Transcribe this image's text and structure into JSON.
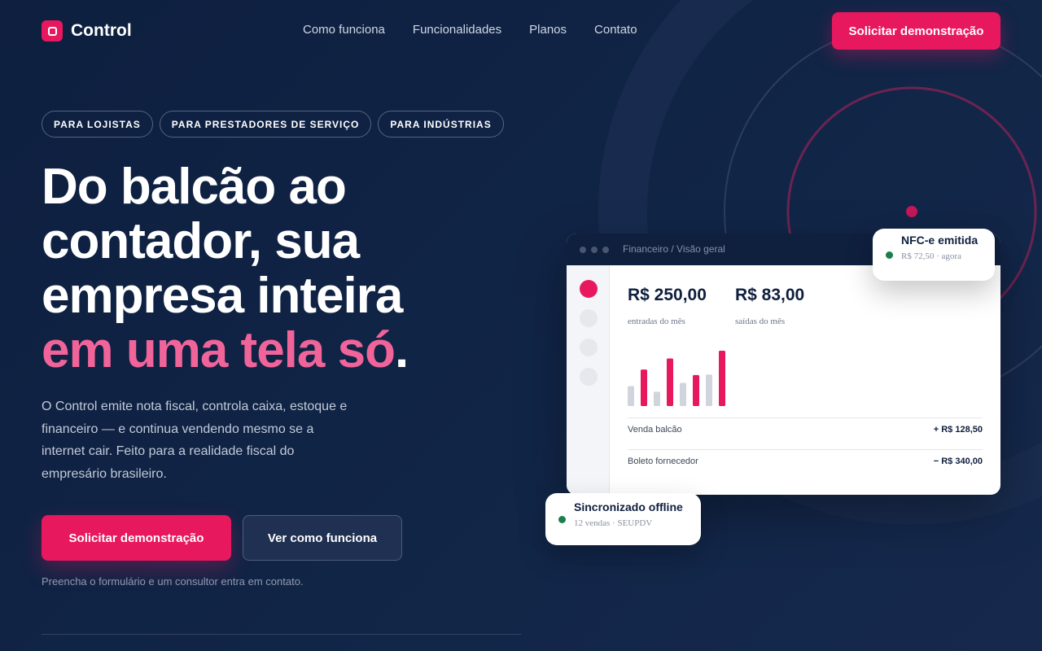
{
  "brand": {
    "name": "Control"
  },
  "nav": {
    "links": [
      "Como funciona",
      "Funcionalidades",
      "Planos",
      "Contato"
    ],
    "cta": "Solicitar demonstração"
  },
  "hero": {
    "tags": [
      "PARA LOJISTAS",
      "PARA PRESTADORES DE SERVIÇO",
      "PARA INDÚSTRIAS"
    ],
    "headline": {
      "line1": "Do balcão ao",
      "line2": "contador, sua",
      "line3": "empresa inteira",
      "accent": "em uma tela só",
      "period": "."
    },
    "description": "O Control emite nota fiscal, controla caixa, estoque e financeiro — e continua vendendo mesmo se a internet cair. Feito para a realidade fiscal do empresário brasileiro.",
    "primary_button": "Solicitar demonstração",
    "secondary_button": "Ver como funciona",
    "note": "Preencha o formulário e um consultor entra em contato."
  },
  "dashboard": {
    "breadcrumb": "Financeiro / Visão geral",
    "stats": [
      {
        "value": "R$ 250,00",
        "label": "entradas do mês"
      },
      {
        "value": "R$ 83,00",
        "label": "saídas do mês"
      }
    ],
    "rows": [
      {
        "label": "Venda balcão",
        "value": "+ R$ 128,50"
      },
      {
        "label": "Boleto fornecedor",
        "value": "− R$ 340,00"
      }
    ],
    "bars": [
      {
        "value": 0.36,
        "accent": false
      },
      {
        "value": 0.66,
        "accent": true
      },
      {
        "value": 0.26,
        "accent": false
      },
      {
        "value": 0.86,
        "accent": true
      },
      {
        "value": 0.42,
        "accent": false
      },
      {
        "value": 0.56,
        "accent": true
      },
      {
        "value": 0.57,
        "accent": false
      },
      {
        "value": 1.0,
        "accent": true
      }
    ]
  },
  "toasts": {
    "nfce": {
      "title": "NFC-e emitida",
      "subtitle": "R$ 72,50 · agora"
    },
    "offline": {
      "title": "Sincronizado offline",
      "subtitle": "12 vendas · SEUPDV"
    }
  },
  "colors": {
    "background": "#0e1f3f",
    "accent": "#e8185f",
    "accent_text": "#f0649a",
    "success": "#1a7f4b",
    "bar_neutral": "#cfd4dd"
  }
}
